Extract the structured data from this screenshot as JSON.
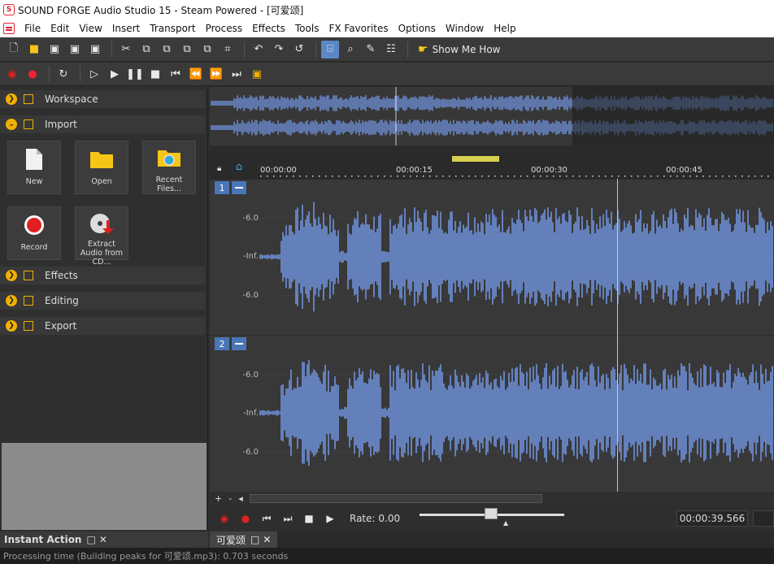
{
  "window": {
    "title": "SOUND FORGE Audio Studio 15 - Steam Powered - [可爱颂]",
    "app_icon_letter": "S"
  },
  "menubar": {
    "items": [
      "File",
      "Edit",
      "View",
      "Insert",
      "Transport",
      "Process",
      "Effects",
      "Tools",
      "FX Favorites",
      "Options",
      "Window",
      "Help"
    ]
  },
  "toolbar": {
    "show_me_how": "Show Me How"
  },
  "left_panel": {
    "sections": {
      "workspace": "Workspace",
      "import": "Import",
      "effects": "Effects",
      "editing": "Editing",
      "export": "Export"
    },
    "tiles": {
      "new": "New",
      "open": "Open",
      "recent": "Recent Files...",
      "record": "Record",
      "extract": "Extract Audio from CD..."
    }
  },
  "ruler": {
    "ticks": [
      "00:00:00",
      "00:00:15",
      "00:00:30",
      "00:00:45"
    ]
  },
  "channels": [
    {
      "number": "1",
      "db_labels": [
        "-6.0",
        "-Inf.",
        "-6.0"
      ]
    },
    {
      "number": "2",
      "db_labels": [
        "-6.0",
        "-Inf.",
        "-6.0"
      ]
    }
  ],
  "transport": {
    "rate_label": "Rate: 0.00",
    "time": "00:00:39.566"
  },
  "hscroll": {
    "plus": "+",
    "minus": "-"
  },
  "tabs": {
    "instant_action": "Instant Action",
    "document": "可爱颂"
  },
  "statusbar": {
    "text": "Processing time (Building peaks for 可爱颂.mp3): 0.703 seconds"
  },
  "colors": {
    "waveform": "#6f92dc",
    "accent": "#4a76b8",
    "yellow": "#f0b000",
    "record_red": "#e02020"
  }
}
